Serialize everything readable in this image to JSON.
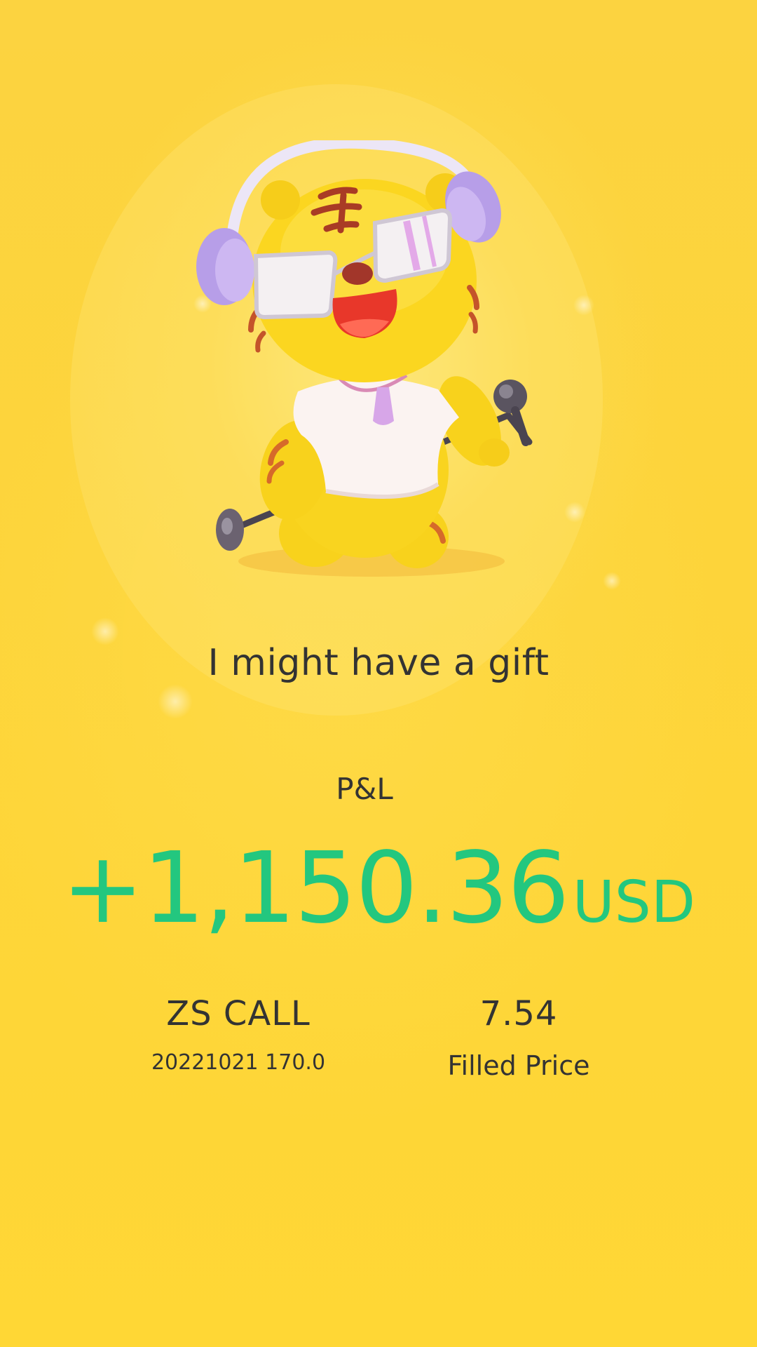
{
  "card": {
    "headline": "I might have a gift",
    "mascot_icon": "tiger-mascot-icon",
    "pnl": {
      "label": "P&L",
      "amount": "+1,150.36",
      "currency": "USD",
      "color": "#23c77f"
    },
    "instrument": {
      "symbol": "ZS CALL",
      "contract": "20221021 170.0"
    },
    "fill": {
      "price": "7.54",
      "label": "Filled Price"
    }
  },
  "colors": {
    "background": "#fdd53a",
    "text": "#333333",
    "accent": "#23c77f"
  }
}
